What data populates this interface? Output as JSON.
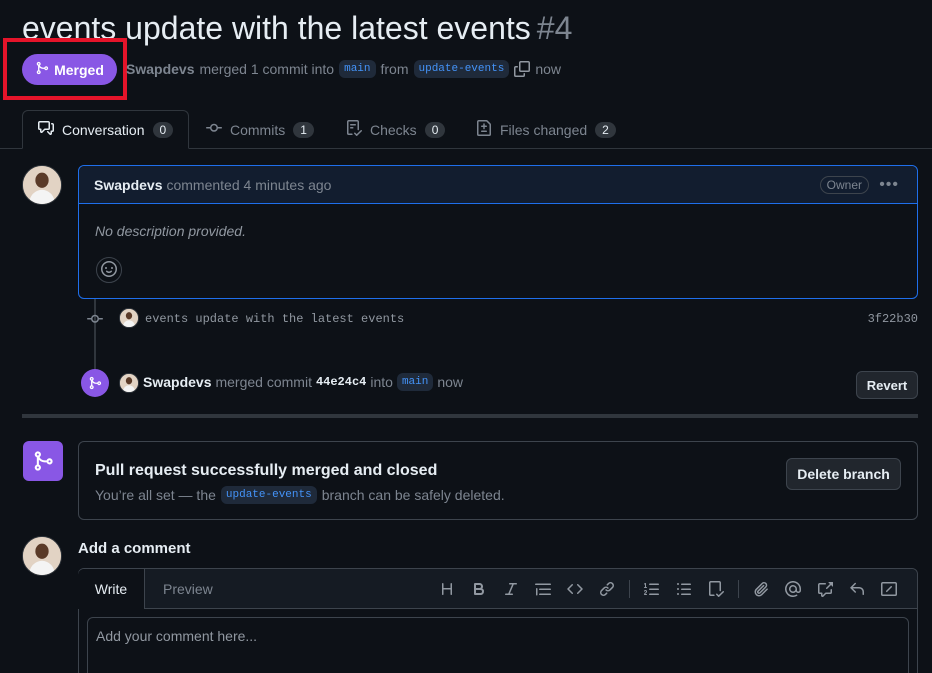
{
  "pr": {
    "title": "events update with the latest events",
    "number": "#4",
    "state_label": "Merged",
    "author": "Swapdevs",
    "merged_text": "merged 1 commit into",
    "base_branch": "main",
    "from_text": "from",
    "head_branch": "update-events",
    "time": "now"
  },
  "tabs": [
    {
      "label": "Conversation",
      "count": "0",
      "icon": "comment-discussion-icon"
    },
    {
      "label": "Commits",
      "count": "1",
      "icon": "git-commit-icon"
    },
    {
      "label": "Checks",
      "count": "0",
      "icon": "checklist-icon"
    },
    {
      "label": "Files changed",
      "count": "2",
      "icon": "file-diff-icon"
    }
  ],
  "comment": {
    "author": "Swapdevs",
    "meta": "commented 4 minutes ago",
    "badge": "Owner",
    "body": "No description provided.",
    "more": "•••"
  },
  "commit": {
    "message": "events update with the latest events",
    "sha": "3f22b30"
  },
  "merge_event": {
    "author": "Swapdevs",
    "text": "merged commit",
    "sha": "44e24c4",
    "into": "into",
    "branch": "main",
    "time": "now",
    "revert_label": "Revert"
  },
  "merged_box": {
    "title": "Pull request successfully merged and closed",
    "sub_prefix": "You’re all set — the",
    "branch": "update-events",
    "sub_suffix": "branch can be safely deleted.",
    "delete_label": "Delete branch"
  },
  "add_comment": {
    "title": "Add a comment",
    "write_tab": "Write",
    "preview_tab": "Preview",
    "placeholder": "Add your comment here..."
  },
  "colors": {
    "merged": "#8957e5",
    "accent_border": "#1f6feb",
    "highlight": "#e5142a"
  }
}
